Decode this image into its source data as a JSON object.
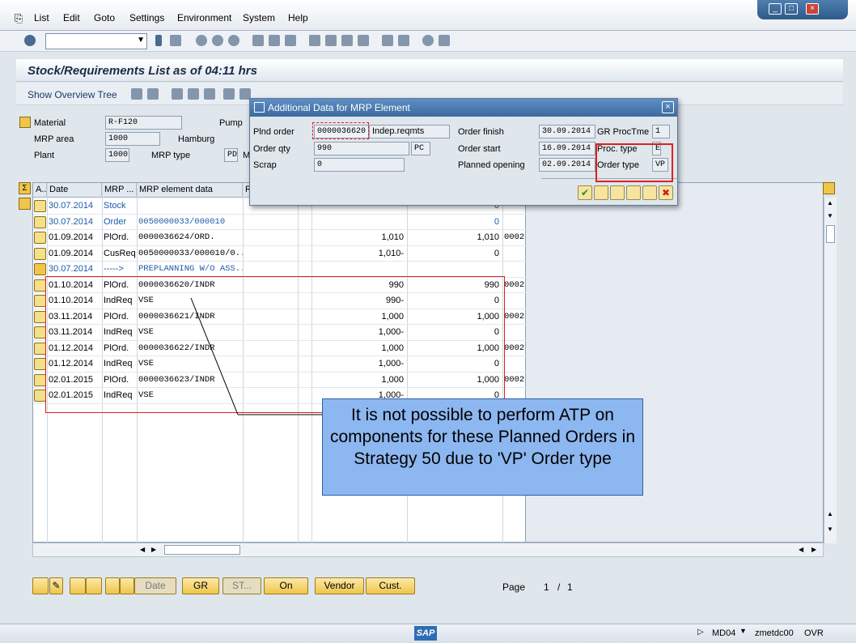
{
  "menu": [
    "List",
    "Edit",
    "Goto",
    "Settings",
    "Environment",
    "System",
    "Help"
  ],
  "window_controls": [
    "_",
    "□",
    "×"
  ],
  "title": "Stock/Requirements List as of 04:11 hrs",
  "app_toolbar": {
    "show_overview_tree": "Show Overview Tree"
  },
  "header": {
    "material_label": "Material",
    "material_value": "R-F120",
    "material_desc": "Pump",
    "mrp_area_label": "MRP area",
    "mrp_area_value": "1000",
    "mrp_area_desc": "Hamburg",
    "plant_label": "Plant",
    "plant_value": "1000",
    "mrp_type_label": "MRP type",
    "mrp_type_value": "PD",
    "mrp_type_tail": "M"
  },
  "grid": {
    "columns": [
      "A...",
      "Date",
      "MRP ...",
      "MRP element data",
      "R"
    ],
    "rows": [
      {
        "date": "30.07.2014",
        "mrp": "Stock",
        "data": "",
        "qty": "",
        "avail": "0",
        "extra": "",
        "style": "blue"
      },
      {
        "date": "30.07.2014",
        "mrp": "Order",
        "data": "0050000033/000010",
        "qty": "",
        "avail": "0",
        "extra": "",
        "style": "blue"
      },
      {
        "date": "01.09.2014",
        "mrp": "PlOrd.",
        "data": "0000036624/ORD.",
        "qty": "1,010",
        "avail": "1,010",
        "extra": "0002",
        "style": ""
      },
      {
        "date": "01.09.2014",
        "mrp": "CusReq",
        "data": "0050000033/000010/0...",
        "qty": "1,010-",
        "avail": "0",
        "extra": "",
        "style": ""
      },
      {
        "date": "30.07.2014",
        "mrp": "----->",
        "data": "PREPLANNING W/O ASS...",
        "qty": "",
        "avail": "",
        "extra": "",
        "style": "blue"
      },
      {
        "date": "01.10.2014",
        "mrp": "PlOrd.",
        "data": "0000036620/INDR",
        "qty": "990",
        "avail": "990",
        "extra": "0002",
        "style": ""
      },
      {
        "date": "01.10.2014",
        "mrp": "IndReq",
        "data": "VSE",
        "qty": "990-",
        "avail": "0",
        "extra": "",
        "style": ""
      },
      {
        "date": "03.11.2014",
        "mrp": "PlOrd.",
        "data": "0000036621/INDR",
        "qty": "1,000",
        "avail": "1,000",
        "extra": "0002",
        "style": ""
      },
      {
        "date": "03.11.2014",
        "mrp": "IndReq",
        "data": "VSE",
        "qty": "1,000-",
        "avail": "0",
        "extra": "",
        "style": ""
      },
      {
        "date": "01.12.2014",
        "mrp": "PlOrd.",
        "data": "0000036622/INDR",
        "qty": "1,000",
        "avail": "1,000",
        "extra": "0002",
        "style": ""
      },
      {
        "date": "01.12.2014",
        "mrp": "IndReq",
        "data": "VSE",
        "qty": "1,000-",
        "avail": "0",
        "extra": "",
        "style": ""
      },
      {
        "date": "02.01.2015",
        "mrp": "PlOrd.",
        "data": "0000036623/INDR",
        "qty": "1,000",
        "avail": "1,000",
        "extra": "0002",
        "style": ""
      },
      {
        "date": "02.01.2015",
        "mrp": "IndReq",
        "data": "VSE",
        "qty": "1,000-",
        "avail": "0",
        "extra": "",
        "style": ""
      }
    ]
  },
  "dialog": {
    "title": "Additional Data for MRP Element",
    "plnd_order_label": "Plnd order",
    "plnd_order_value": "0000036620",
    "plnd_order_type": "Indep.reqmts",
    "order_qty_label": "Order qty",
    "order_qty_value": "990",
    "order_qty_unit": "PC",
    "scrap_label": "Scrap",
    "scrap_value": "0",
    "order_finish_label": "Order finish",
    "order_finish_value": "30.09.2014",
    "order_start_label": "Order start",
    "order_start_value": "16.09.2014",
    "planned_opening_label": "Planned opening",
    "planned_opening_value": "02.09.2014",
    "gr_proctme_label": "GR ProcTme",
    "gr_proctme_value": "1",
    "proc_type_label": "Proc. type",
    "proc_type_value": "E",
    "order_type_label": "Order type",
    "order_type_value": "VP"
  },
  "bottom_buttons": {
    "date": "Date",
    "gr": "GR",
    "st": "ST...",
    "on": "On",
    "vendor": "Vendor",
    "cust": "Cust."
  },
  "page_label": "Page",
  "page_current": "1",
  "page_sep": "/",
  "page_total": "1",
  "callout": "It is not possible to perform ATP on components for these Planned Orders in Strategy 50 due to 'VP' Order type",
  "status": {
    "logo": "SAP",
    "transaction": "MD04",
    "server": "zmetdc00",
    "mode": "OVR"
  },
  "colors": {
    "accent": "#3c6aa0",
    "highlight": "#e0201c",
    "callout_bg": "#8db7f0"
  }
}
